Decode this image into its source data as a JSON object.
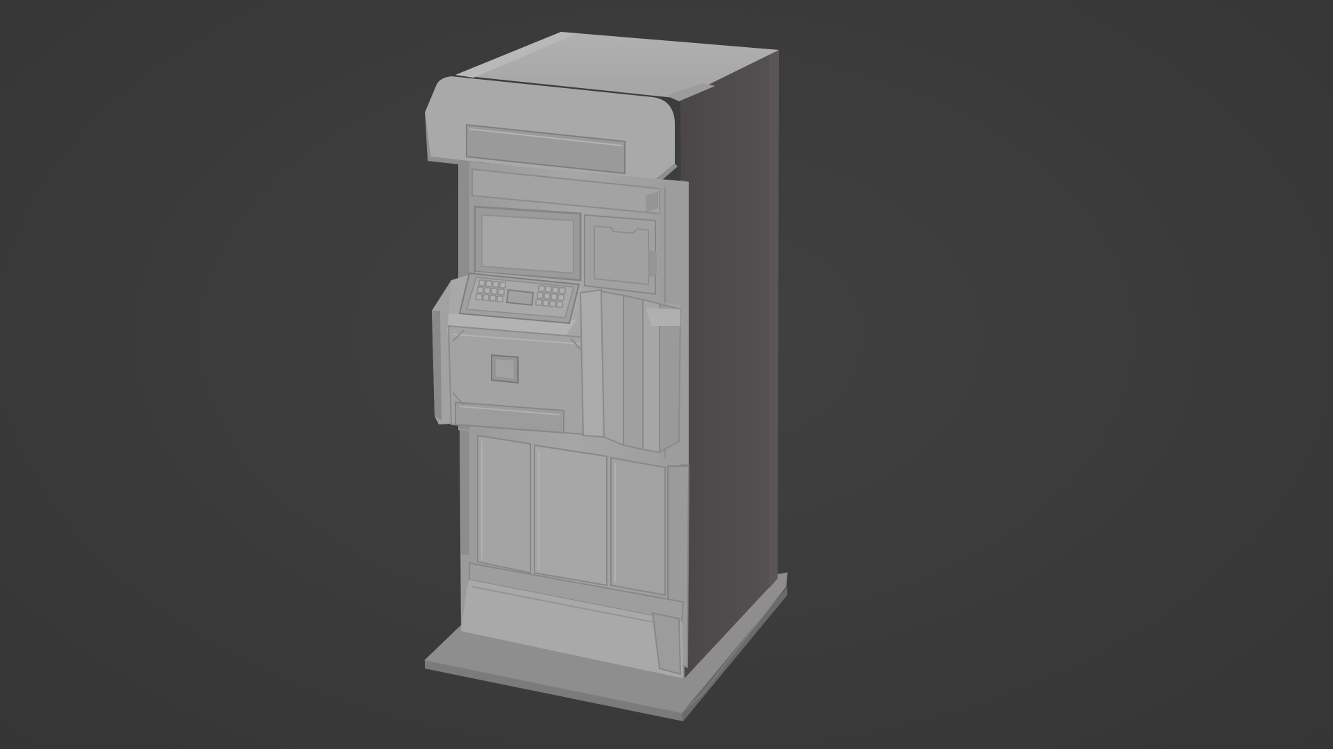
{
  "viewport": {
    "background": "#3a3a3a",
    "object_color": "#a3a3a3",
    "side_color": "#4e4a4d"
  },
  "model": {
    "name": "",
    "parts": {
      "top_canopy": "canopy",
      "sign_panel": "sign-slot",
      "screen_frame": "screen",
      "keypad": "keypad",
      "control_shelf": "console",
      "card_slot": "card-slot",
      "lower_doors": "doors",
      "plinth": "base-plinth"
    },
    "keypad_keys": 24
  }
}
